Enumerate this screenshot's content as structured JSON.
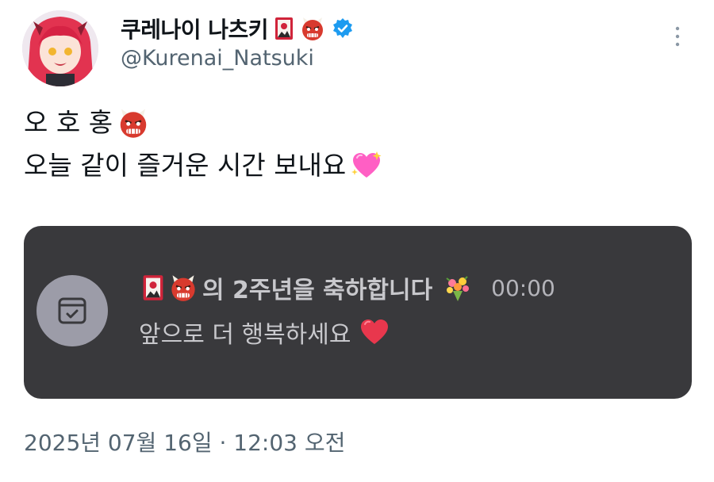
{
  "profile": {
    "display_name": "쿠레나이 나츠키",
    "handle": "@Kurenai_Natsuki",
    "name_emojis": [
      "hanafuda-card-icon",
      "ogre-icon"
    ],
    "verified": true,
    "verified_color": "#1d9bf0"
  },
  "tweet": {
    "lines": [
      {
        "text": "오 호 홍",
        "emoji": "ogre-icon"
      },
      {
        "text": "오늘 같이 즐거운 시간 보내요",
        "emoji": "sparkling-heart-icon"
      }
    ]
  },
  "card": {
    "title": "의 2주년을 축하합니다",
    "title_emojis": [
      "hanafuda-card-icon",
      "ogre-icon"
    ],
    "trailing_emoji": "bouquet-icon",
    "time": "00:00",
    "body": "앞으로 더 행복하세요",
    "body_emoji": "red-heart-icon",
    "icon": "calendar-check-icon",
    "background": "#39393c"
  },
  "footer": {
    "timestamp": "2025년 07월 16일 · 12:03 오전"
  },
  "colors": {
    "text_primary": "#0f1419",
    "text_secondary": "#536471",
    "accent": "#1d9bf0"
  }
}
